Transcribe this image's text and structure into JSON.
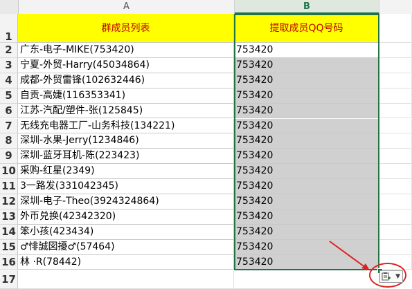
{
  "columns": {
    "a": "A",
    "b": "B"
  },
  "rows": [
    "1",
    "2",
    "3",
    "4",
    "5",
    "6",
    "7",
    "8",
    "9",
    "10",
    "11",
    "12",
    "13",
    "14",
    "15",
    "16",
    "17"
  ],
  "header": {
    "a": "群成员列表",
    "b": "提取成员QQ号码"
  },
  "data": [
    {
      "a": "广东-电子-MIKE(753420)",
      "b": "753420"
    },
    {
      "a": "宁夏-外贸-Harry(45034864)",
      "b": "753420"
    },
    {
      "a": "成都-外贸雷锋(102632446)",
      "b": "753420"
    },
    {
      "a": "自贡-高婕(116353341)",
      "b": "753420"
    },
    {
      "a": "江苏-汽配/塑件-张(125845)",
      "b": "753420"
    },
    {
      "a": "无线充电器工厂-山务科技(134221)",
      "b": "753420"
    },
    {
      "a": "深圳-水果-Jerry(1234846)",
      "b": "753420"
    },
    {
      "a": "深圳-蓝牙耳机-陈(223423)",
      "b": "753420"
    },
    {
      "a": "采购-红星(2349)",
      "b": "753420"
    },
    {
      "a": "3一路发(331042345)",
      "b": "753420"
    },
    {
      "a": "深圳-电子-Theo(3924324864)",
      "b": "753420"
    },
    {
      "a": "外币兑换(42342320)",
      "b": "753420"
    },
    {
      "a": "笨小孩(423434)",
      "b": "753420"
    },
    {
      "a": "♂悱誠図擾♂(57464)",
      "b": "753420"
    },
    {
      "a": "林 ·R(78442)",
      "b": "753420"
    }
  ],
  "colors": {
    "header_fill": "#ffff00",
    "header_text": "#c00000",
    "selection": "#217346",
    "annotation": "#e02020",
    "filled_cell": "#d0d0d0"
  },
  "icons": {
    "paste_options": "paste-options-icon",
    "annotation_arrow": "arrow-icon"
  }
}
